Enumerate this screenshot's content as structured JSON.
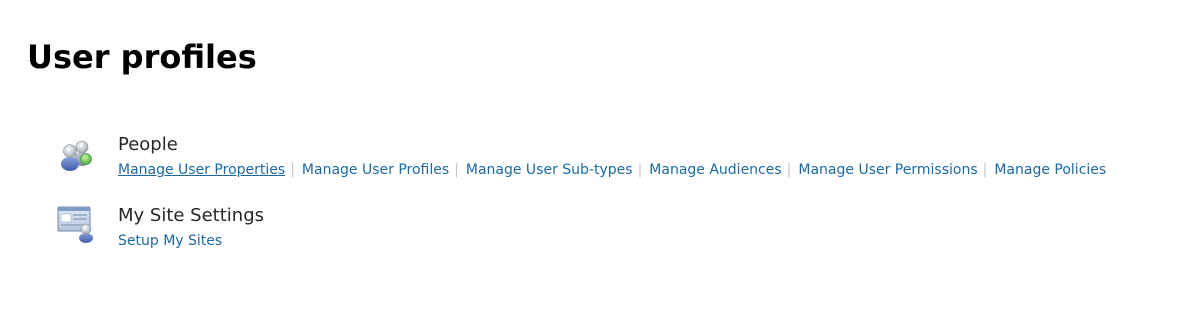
{
  "page": {
    "title": "User profiles"
  },
  "sections": [
    {
      "heading": "People",
      "icon": "people-icon",
      "links": [
        "Manage User Properties",
        "Manage User Profiles",
        "Manage User Sub-types",
        "Manage Audiences",
        "Manage User Permissions",
        "Manage Policies"
      ]
    },
    {
      "heading": "My Site Settings",
      "icon": "my-site-icon",
      "links": [
        "Setup My Sites"
      ]
    }
  ],
  "colors": {
    "link": "#1c6aa0",
    "heading": "#262626",
    "separator": "#c6c6c6"
  },
  "separator": "|"
}
